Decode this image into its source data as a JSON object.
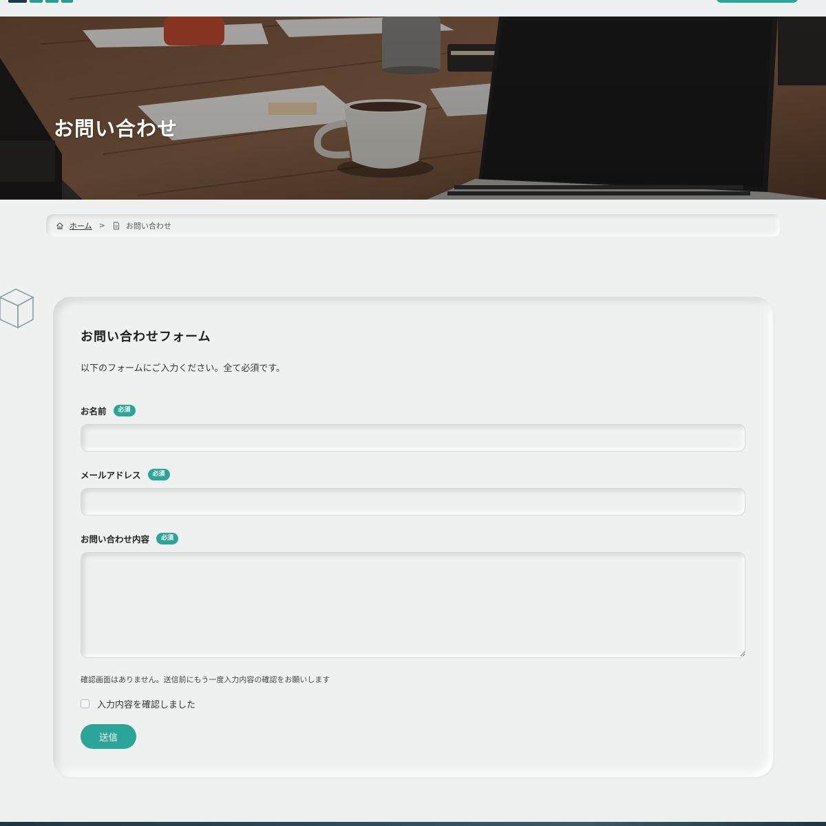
{
  "hero": {
    "title": "お問い合わせ"
  },
  "breadcrumb": {
    "home": "ホーム",
    "separator": ">",
    "current": "お問い合わせ"
  },
  "form": {
    "title": "お問い合わせフォーム",
    "description": "以下のフォームにご入力ください。全て必須です。",
    "fields": [
      {
        "label": "お名前",
        "badge": "必須",
        "value": ""
      },
      {
        "label": "メールアドレス",
        "badge": "必須",
        "value": ""
      },
      {
        "label": "お問い合わせ内容",
        "badge": "必須",
        "value": ""
      }
    ],
    "note": "確認画面はありません。送信前にもう一度入力内容の確認をお願いします",
    "confirm_label": "入力内容を確認しました",
    "confirm_checked": false,
    "submit_label": "送信"
  },
  "colors": {
    "accent": "#2aa598",
    "background": "#eff1f1"
  },
  "icons": [
    "home-icon",
    "page-icon",
    "cube-icon"
  ]
}
